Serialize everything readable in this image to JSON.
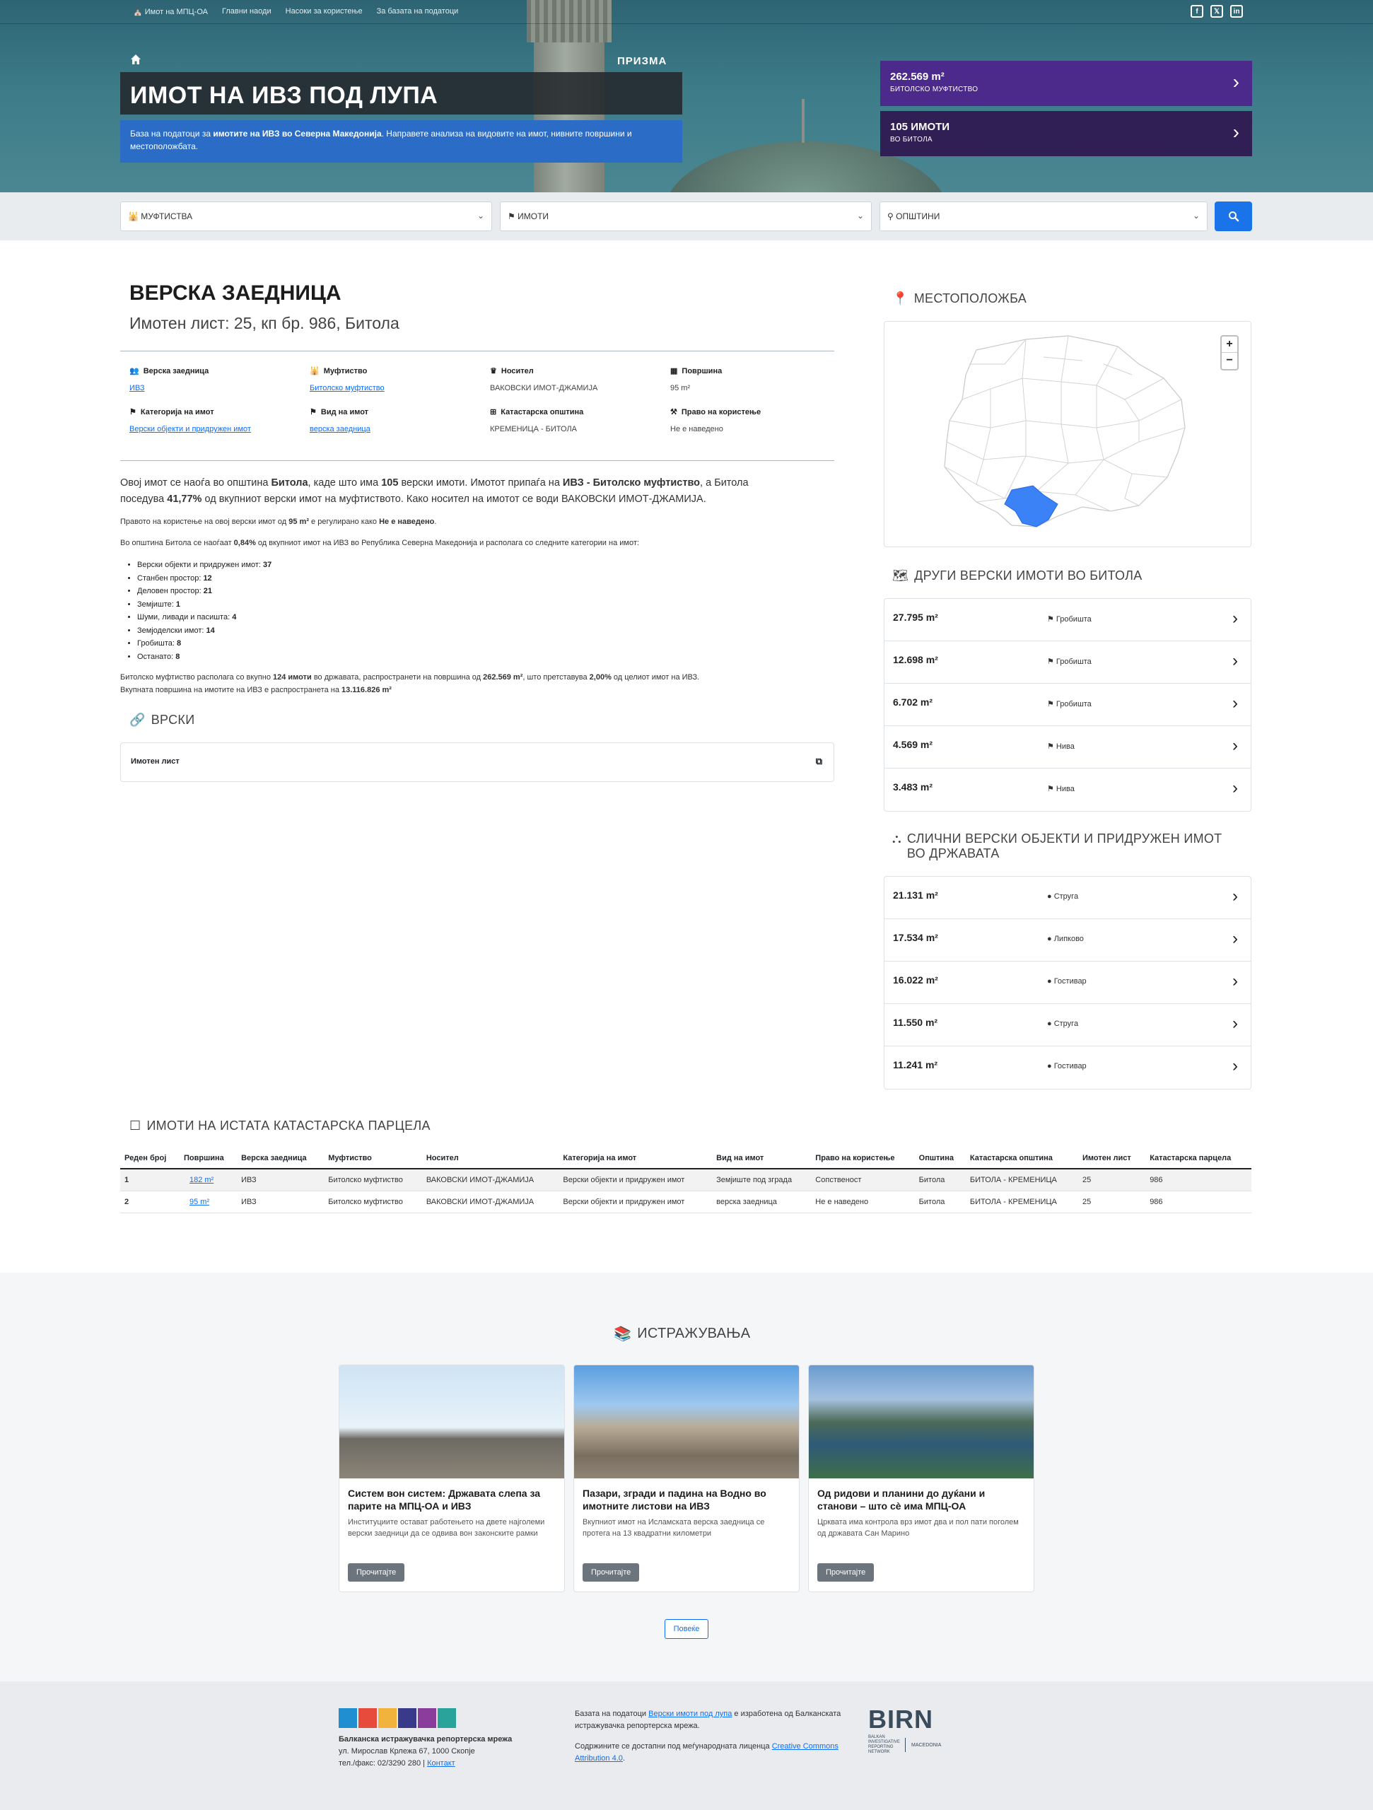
{
  "topnav": {
    "items": [
      "Имот на МПЦ-ОА",
      "Главни наоди",
      "Насоки за користење",
      "За базата на податоци"
    ],
    "social": [
      "facebook-icon",
      "x-icon",
      "linkedin-icon"
    ]
  },
  "hero": {
    "brand": "ПРИЗМА",
    "title": "ИМОТ НА ИВЗ ПОД ЛУПА",
    "desc_a": "База на податоци за ",
    "desc_b": "имотите на ИВЗ во Северна Македонија",
    "desc_c": ". Направете анализа на видовите на имот, нивните површини и местоположбата.",
    "stat1": {
      "value": "262.569 m²",
      "label": "БИТОЛСКО МУФТИСТВО",
      "color": "#4b2a8c"
    },
    "stat2": {
      "value": "105 ИМОТИ",
      "label": "ВО БИТОЛА",
      "color": "#2f1f55"
    }
  },
  "search": {
    "muftistva": "МУФТИСТВА",
    "imoti": "ИМОТИ",
    "opstini": "ОПШТИНИ",
    "accent": "#1a73e8"
  },
  "property": {
    "title": "ВЕРСКА ЗАЕДНИЦА",
    "subtitle": "Имотен лист: 25, кп бр. 986, Битола",
    "fields": [
      {
        "label": "Верска заедница",
        "value": "ИВЗ",
        "link": true
      },
      {
        "label": "Муфтиство",
        "value": "Битолско муфтиство",
        "link": true
      },
      {
        "label": "Носител",
        "value": "ВАКОВСКИ ИМОТ-ДЖАМИЈА",
        "link": false
      },
      {
        "label": "Површина",
        "value": "95 m²",
        "link": false
      },
      {
        "label": "Категорија на имот",
        "value": "Верски објекти и придружен имот",
        "link": true
      },
      {
        "label": "Вид на имот",
        "value": "верска заедница",
        "link": true
      },
      {
        "label": "Катастарска општина",
        "value": "КРЕМЕНИЦА - БИТОЛА",
        "link": false
      },
      {
        "label": "Право на користење",
        "value": "Не е наведено",
        "link": false
      }
    ]
  },
  "text": {
    "p1_a": "Овој имот се наоѓа во општина ",
    "p1_b": "Битола",
    "p1_c": ", каде што има ",
    "p1_d": "105",
    "p1_e": " верски имоти. Имотот припаѓа на ",
    "p1_f": "ИВЗ - Битолско муфтиство",
    "p1_g": ", а Битола",
    "p1_h": "поседува ",
    "p1_i": "41,77%",
    "p1_j": " од вкупниот верски имот на муфтиството. Како носител на имотот се води ВАКОВСКИ ИМОТ-ДЖАМИЈА.",
    "p2_a": "Правото на користење на овој верски имот од ",
    "p2_b": "95 m²",
    "p2_c": " е регулирано како ",
    "p2_d": "Не е наведено",
    "p2_e": ".",
    "p3_a": "Во општина Битола се наоѓаат ",
    "p3_b": "0,84%",
    "p3_c": " од вкупниот имот на ИВЗ во Република Северна Македонија и располага со следните категории на имот:",
    "bullets": [
      {
        "k": "Верски објекти и придружен имот: ",
        "v": "37"
      },
      {
        "k": "Станбен простор: ",
        "v": "12"
      },
      {
        "k": "Деловен простор: ",
        "v": "21"
      },
      {
        "k": "Земјиште: ",
        "v": "1"
      },
      {
        "k": "Шуми, ливади и пасишта: ",
        "v": "4"
      },
      {
        "k": "Земјоделски имот: ",
        "v": "14"
      },
      {
        "k": "Гробишта: ",
        "v": "8"
      },
      {
        "k": "Останато: ",
        "v": "8"
      }
    ],
    "p4_a": "Битолско муфтиство располага со вкупно ",
    "p4_b": "124 имоти",
    "p4_c": " во државата, распространети на површина од ",
    "p4_d": "262.569 m²",
    "p4_e": ", што претставува ",
    "p4_f": "2,00%",
    "p4_g": " од целиот имот на ИВЗ.",
    "p5_a": "Вкупната површина на имотите на ИВЗ е распространета на ",
    "p5_b": "13.116.826 m²"
  },
  "links": {
    "heading": "ВРСКИ",
    "item": "Имотен лист"
  },
  "location": {
    "heading": "МЕСТОПОЛОЖБА",
    "zoom_in": "+",
    "zoom_out": "−",
    "highlight": "#3b82f6"
  },
  "other": {
    "heading": "ДРУГИ ВЕРСКИ ИМОТИ ВО БИТОЛА",
    "items": [
      {
        "area": "27.795 m²",
        "type": "Гробишта"
      },
      {
        "area": "12.698 m²",
        "type": "Гробишта"
      },
      {
        "area": "6.702 m²",
        "type": "Гробишта"
      },
      {
        "area": "4.569 m²",
        "type": "Нива"
      },
      {
        "area": "3.483 m²",
        "type": "Нива"
      }
    ]
  },
  "similar": {
    "heading_1": "СЛИЧНИ ВЕРСКИ ОБЈЕКТИ И ПРИДРУЖЕН ИМОТ",
    "heading_2": "ВО ДРЖАВАТА",
    "items": [
      {
        "area": "21.131 m²",
        "place": "Струга"
      },
      {
        "area": "17.534 m²",
        "place": "Липково"
      },
      {
        "area": "16.022 m²",
        "place": "Гостивар"
      },
      {
        "area": "11.550 m²",
        "place": "Струга"
      },
      {
        "area": "11.241 m²",
        "place": "Гостивар"
      }
    ]
  },
  "parcel": {
    "heading": "ИМОТИ НА ИСТАТА КАТАСТАРСКА ПАРЦЕЛА",
    "columns": [
      "Реден број",
      "Површина",
      "Верска заедница",
      "Муфтиство",
      "Носител",
      "Категорија на имот",
      "Вид на имот",
      "Право на користење",
      "Општина",
      "Катастарска општина",
      "Имотен лист",
      "Катастарска парцела"
    ],
    "rows": [
      [
        "1",
        "182 m²",
        "ИВЗ",
        "Битолско муфтиство",
        "ВАКОВСКИ ИМОТ-ДЖАМИЈА",
        "Верски објекти и придружен имот",
        "Земјиште под зграда",
        "Сопственост",
        "Битола",
        "БИТОЛА - КРЕМЕНИЦА",
        "25",
        "986"
      ],
      [
        "2",
        "95 m²",
        "ИВЗ",
        "Битолско муфтиство",
        "ВАКОВСКИ ИМОТ-ДЖАМИЈА",
        "Верски објекти и придружен имот",
        "верска заедница",
        "Не е наведено",
        "Битола",
        "БИТОЛА - КРЕМЕНИЦА",
        "25",
        "986"
      ]
    ]
  },
  "research": {
    "heading": "ИСТРАЖУВАЊА",
    "cards": [
      {
        "title": "Систем вон систем: Државата слепа за парите на МПЦ-ОА и ИВЗ",
        "desc": "Институциите остават работењето на двете најголеми верски заедници да се одвива вон законските рамки",
        "btn": "Прочитајте"
      },
      {
        "title": "Пазари, згради и падина на Водно во имотните листови на ИВЗ",
        "desc": "Вкупниот имот на Исламската верска заедница се протега на 13 квадратни километри",
        "btn": "Прочитајте"
      },
      {
        "title": "Од ридови и планини до дуќани и станови – што сè има МПЦ-ОА",
        "desc": "Црквата има контрола врз имот двa и пол пати поголем од државата Сан Марино",
        "btn": "Прочитајте"
      }
    ],
    "more": "Повеќе"
  },
  "footer": {
    "logo": "ПРИЗМА",
    "org": "Балканска истражувачка репортерска мрежа",
    "address": "ул. Мирослав Крлежа 67, 1000 Скопје",
    "phone": "тел./факс: 02/3290 280 | ",
    "contact": "Контакт",
    "t1_a": "Базата на податоци ",
    "t1_b": "Верски имоти под лупа",
    "t1_c": " е изработена од Балканската истражувачка репортерска мрежа.",
    "t2_a": "Содржините се достапни под меѓународната лиценца ",
    "t2_b": "Creative Commons Attribution 4.0",
    "t2_c": ".",
    "birn": "BIRN",
    "birn_sub": "BALKAN INVESTIGATIVE REPORTING NETWORK",
    "birn_country": "MACEDONIA"
  }
}
